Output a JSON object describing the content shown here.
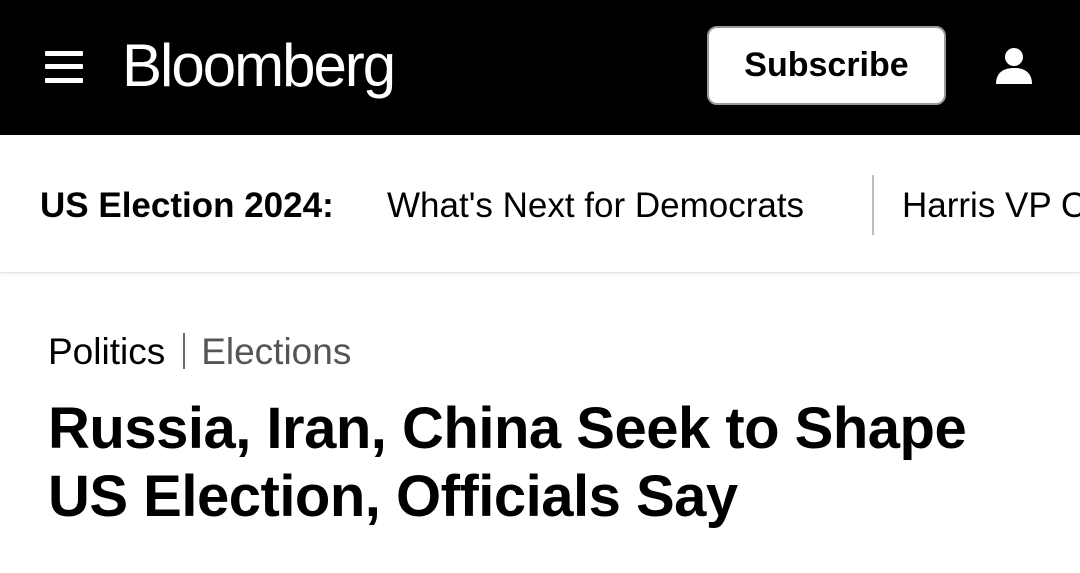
{
  "header": {
    "menu_icon": "hamburger-menu-icon",
    "logo_text": "Bloomberg",
    "subscribe_label": "Subscribe",
    "account_icon": "user-account-icon",
    "background_color": "#000000",
    "text_color": "#ffffff"
  },
  "topic_nav": {
    "topic_label": "US Election 2024:",
    "links": [
      {
        "label": "What's Next for Democrats"
      },
      {
        "label": "Harris VP C"
      }
    ]
  },
  "article": {
    "breadcrumb": {
      "primary": "Politics",
      "secondary": "Elections"
    },
    "headline": "Russia, Iran, China Seek to Shape US Election, Officials Say"
  }
}
